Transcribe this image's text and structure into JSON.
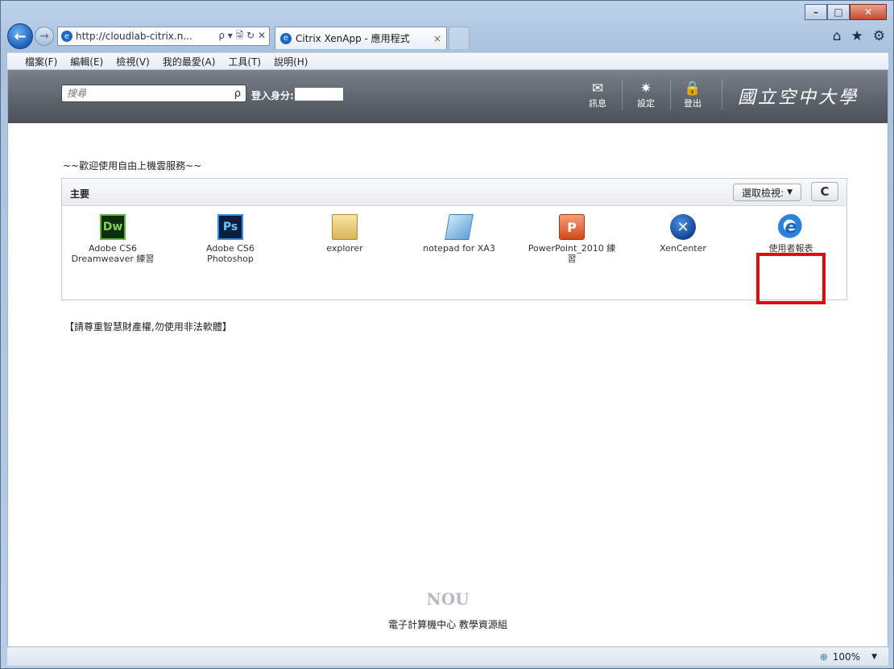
{
  "browser": {
    "url": "http://cloudlab-citrix.n...",
    "url_controls": "ρ ▾ 🗟 ↻ ✕",
    "tab_title": "Citrix XenApp - 應用程式",
    "tab_close": "×",
    "back_icon": "arrow-left-icon",
    "forward_icon": "arrow-right-icon",
    "nav_icons": {
      "home": "⌂",
      "favorites": "★",
      "tools": "⚙"
    }
  },
  "menu": [
    "檔案(F)",
    "編輯(E)",
    "檢視(V)",
    "我的最愛(A)",
    "工具(T)",
    "說明(H)"
  ],
  "header": {
    "search_placeholder": "搜尋",
    "search_icon": "ρ",
    "login_label": "登入身分:",
    "buttons": [
      {
        "icon": "✉",
        "label": "訊息"
      },
      {
        "icon": "✷",
        "label": "設定"
      },
      {
        "icon": "🔒",
        "label": "登出"
      }
    ],
    "brand": "國立空中大學"
  },
  "welcome": "~~歡迎使用自由上機雲服務~~",
  "panel": {
    "title": "主要",
    "view_button": "選取檢視:",
    "view_caret": "▼",
    "refresh_glyph": "C"
  },
  "apps": [
    {
      "name": "Adobe CS6 Dreamweaver 練習",
      "glyph": "Dw"
    },
    {
      "name": "Adobe CS6 Photoshop",
      "glyph": "Ps"
    },
    {
      "name": "explorer",
      "glyph": ""
    },
    {
      "name": "notepad for XA3",
      "glyph": ""
    },
    {
      "name": "PowerPoint_2010 練習",
      "glyph": "P"
    },
    {
      "name": "XenCenter",
      "glyph": "✕"
    },
    {
      "name": "使用者報表",
      "glyph": "e"
    }
  ],
  "notice": "【請尊重智慧財產權,勿使用非法軟體】",
  "footer": {
    "logo": "NOU",
    "text": "電子計算機中心 教學資源組"
  },
  "status": {
    "zoom": "100%",
    "zoom_caret": "▼"
  },
  "colors": {
    "highlight": "#e10d0d",
    "header_bg": "#5e646d",
    "browser_accent": "#1a67c9"
  }
}
